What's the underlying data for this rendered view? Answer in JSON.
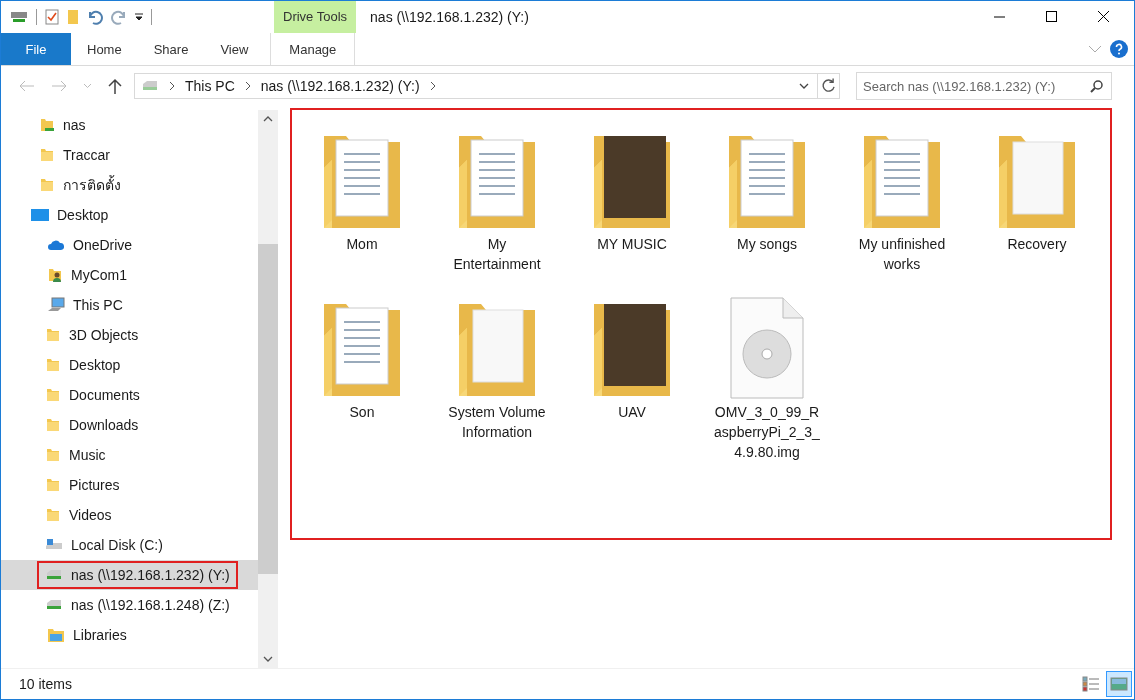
{
  "window": {
    "title": "nas (\\\\192.168.1.232) (Y:)"
  },
  "ribbon": {
    "context_label": "Drive Tools",
    "tabs": [
      {
        "label": "File",
        "kind": "file"
      },
      {
        "label": "Home",
        "kind": "tab"
      },
      {
        "label": "Share",
        "kind": "tab"
      },
      {
        "label": "View",
        "kind": "tab"
      },
      {
        "label": "Manage",
        "kind": "context"
      }
    ]
  },
  "address": {
    "crumbs": [
      "This PC",
      "nas (\\\\192.168.1.232) (Y:)"
    ]
  },
  "search": {
    "placeholder": "Search nas (\\\\192.168.1.232) (Y:)"
  },
  "sidebar": {
    "items": [
      {
        "label": "nas",
        "kind": "network-folder",
        "selected": false,
        "highlighted": false
      },
      {
        "label": "Traccar",
        "kind": "folder",
        "selected": false,
        "highlighted": false
      },
      {
        "label": "การติดตั้ง",
        "kind": "folder",
        "selected": false,
        "highlighted": false
      },
      {
        "label": "Desktop",
        "kind": "desktop",
        "selected": false,
        "highlighted": false,
        "children": [
          {
            "label": "OneDrive",
            "kind": "cloud",
            "selected": false,
            "highlighted": false
          },
          {
            "label": "MyCom1",
            "kind": "user-folder",
            "selected": false,
            "highlighted": false
          },
          {
            "label": "This PC",
            "kind": "pc",
            "selected": false,
            "highlighted": false,
            "children": [
              {
                "label": "3D Objects",
                "kind": "folder",
                "selected": false,
                "highlighted": false
              },
              {
                "label": "Desktop",
                "kind": "folder",
                "selected": false,
                "highlighted": false
              },
              {
                "label": "Documents",
                "kind": "folder",
                "selected": false,
                "highlighted": false
              },
              {
                "label": "Downloads",
                "kind": "folder",
                "selected": false,
                "highlighted": false
              },
              {
                "label": "Music",
                "kind": "folder",
                "selected": false,
                "highlighted": false
              },
              {
                "label": "Pictures",
                "kind": "folder",
                "selected": false,
                "highlighted": false
              },
              {
                "label": "Videos",
                "kind": "folder",
                "selected": false,
                "highlighted": false
              },
              {
                "label": "Local Disk (C:)",
                "kind": "drive",
                "selected": false,
                "highlighted": false
              },
              {
                "label": "nas (\\\\192.168.1.232) (Y:)",
                "kind": "network-drive",
                "selected": true,
                "highlighted": true
              },
              {
                "label": "nas (\\\\192.168.1.248) (Z:)",
                "kind": "network-drive",
                "selected": false,
                "highlighted": false
              }
            ]
          },
          {
            "label": "Libraries",
            "kind": "library",
            "selected": false,
            "highlighted": false
          }
        ]
      }
    ]
  },
  "content": {
    "highlighted": true,
    "items": [
      {
        "name": "Mom",
        "kind": "doc-folder"
      },
      {
        "name": "My Entertainment",
        "kind": "doc-folder"
      },
      {
        "name": "MY MUSIC",
        "kind": "photo-folder"
      },
      {
        "name": "My songs",
        "kind": "doc-folder"
      },
      {
        "name": "My unfinished works",
        "kind": "doc-folder"
      },
      {
        "name": "Recovery",
        "kind": "folder"
      },
      {
        "name": "Son",
        "kind": "doc-folder"
      },
      {
        "name": "System Volume Information",
        "kind": "folder"
      },
      {
        "name": "UAV",
        "kind": "photo-folder"
      },
      {
        "name": "OMV_3_0_99_RaspberryPi_2_3_4.9.80.img",
        "kind": "disc-image"
      }
    ]
  },
  "status_bar": {
    "count": "10 items",
    "views": [
      {
        "kind": "details",
        "selected": false
      },
      {
        "kind": "large-icons",
        "selected": true
      }
    ]
  }
}
